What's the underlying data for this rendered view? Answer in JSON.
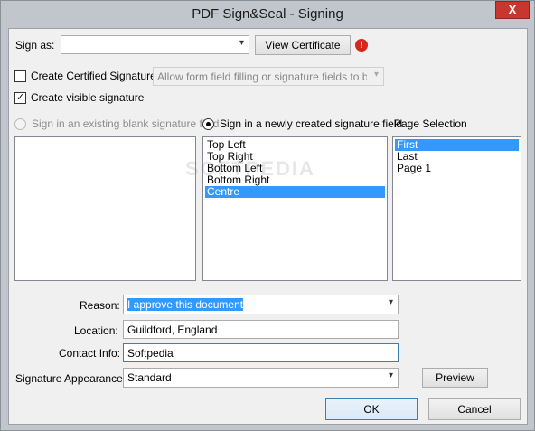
{
  "window": {
    "title": "PDF Sign&Seal - Signing",
    "close_glyph": "X"
  },
  "sign_as": {
    "label": "Sign as:",
    "value": "",
    "view_certificate_label": "View Certificate",
    "warning_glyph": "!"
  },
  "certified": {
    "label": "Create Certified Signature",
    "checked": false,
    "permission_value": "Allow form field filling or signature fields to be signed"
  },
  "visible": {
    "label": "Create visible signature",
    "checked": true,
    "check_glyph": "✓"
  },
  "existing_field_label": "Sign in an existing blank signature field",
  "new_field_label": "Sign in a newly created signature field",
  "page_selection_label": "Page Selection",
  "positions": {
    "items": [
      "Top Left",
      "Top Right",
      "Bottom Left",
      "Bottom Right",
      "Centre"
    ],
    "selected": "Centre"
  },
  "pages": {
    "items": [
      "First",
      "Last",
      "Page 1"
    ],
    "selected": "First"
  },
  "watermark": "SOFTPEDIA",
  "form": {
    "reason_label": "Reason:",
    "reason_value": "I approve this document",
    "location_label": "Location:",
    "location_value": "Guildford, England",
    "contact_label": "Contact Info:",
    "contact_value": "Softpedia",
    "appearance_label": "Signature Appearance:",
    "appearance_value": "Standard",
    "preview_label": "Preview"
  },
  "buttons": {
    "ok_label": "OK",
    "cancel_label": "Cancel"
  },
  "colors": {
    "selection": "#3399ff",
    "close": "#c7362f",
    "warning": "#d9261c"
  }
}
